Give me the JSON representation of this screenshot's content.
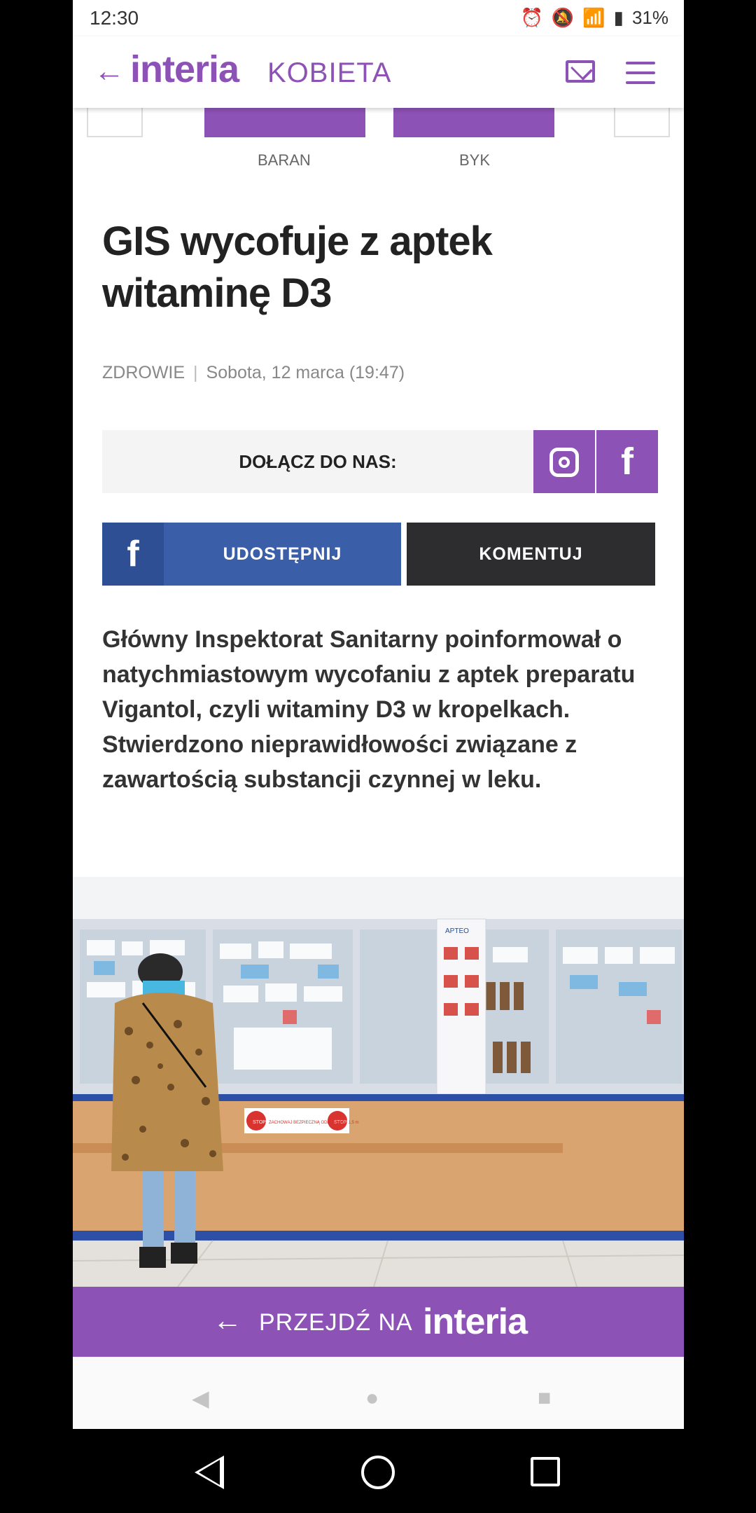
{
  "status": {
    "time": "12:30",
    "battery": "31%",
    "icons": [
      "alarm-icon",
      "mute-icon",
      "wifi-icon",
      "signal-icon",
      "battery-icon"
    ]
  },
  "header": {
    "logo": "interia",
    "section": "KOBIETA",
    "icons": [
      "back-arrow-icon",
      "mail-icon",
      "menu-icon"
    ]
  },
  "horoscope": {
    "items": [
      "BARAN",
      "BYK"
    ]
  },
  "article": {
    "title": "GIS wycofuje z aptek witaminę D3",
    "category": "ZDROWIE",
    "date": "Sobota, 12 marca (19:47)",
    "join_label": "DOŁĄCZ DO NAS:",
    "share_label": "UDOSTĘPNIJ",
    "comment_label": "KOMENTUJ",
    "lead": "Główny Inspektorat Sanitarny poinformował o natychmiastowym wycofaniu z aptek preparatu Vigantol, czyli witaminy D3 w kropelkach. Stwierdzono nieprawidłowości związane z zawartością substancji czynnej w leku."
  },
  "photo": {
    "labels": [
      "APTEO",
      "STOP",
      "ZACHOWAJ BEZPIECZNĄ ODLEGŁOŚĆ 1,5 m",
      "STOP"
    ]
  },
  "footer": {
    "goto_label": "PRZEJDŹ NA",
    "goto_brand": "interia"
  },
  "colors": {
    "brand_purple": "#8d52b5",
    "facebook_blue": "#3b5ea8",
    "dark": "#2d2d30"
  }
}
